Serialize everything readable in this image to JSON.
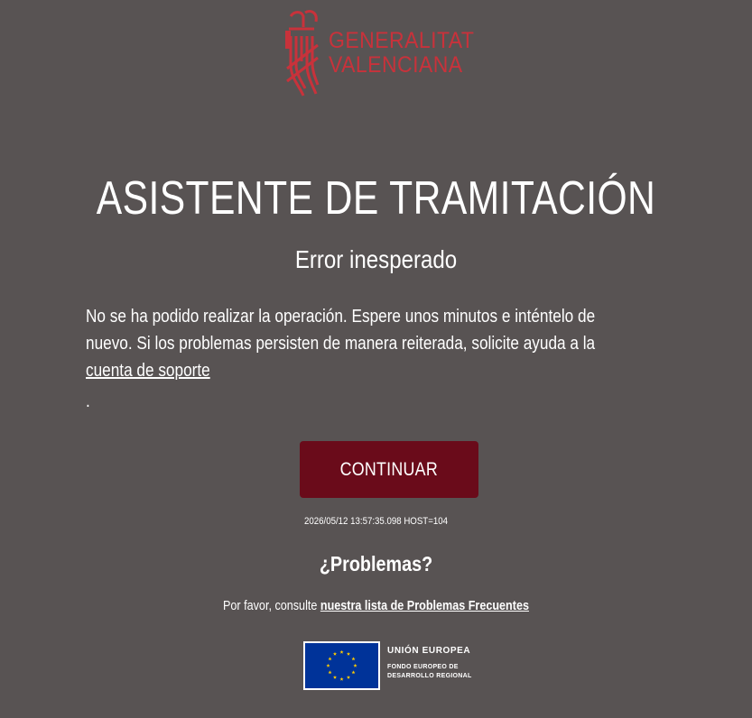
{
  "header": {
    "logo_line1": "GENERALITAT",
    "logo_line2": "VALENCIANA",
    "logo_icon": "generalitat-emblem-icon",
    "brand_color": "#c8323b"
  },
  "main": {
    "title": "ASISTENTE DE TRAMITACIÓN",
    "subtitle": "Error inesperado",
    "message": "No se ha podido realizar la operación. Espere unos minutos e inténtelo de nuevo. Si los problemas persisten de manera reiterada, solicite ayuda a la",
    "support_link": "cuenta de soporte",
    "message_end": ".",
    "continue_label": "CONTINUAR",
    "button_color": "#6a0b1a",
    "timestamp": "2026/05/12 13:57:35.098 HOST=104"
  },
  "problems": {
    "title": "¿Problemas?",
    "text": "Por favor, consulte",
    "link": "nuestra lista de Problemas Frecuentes"
  },
  "footer": {
    "eu_flag_icon": "eu-flag-icon",
    "eu_name": "UNIÓN EUROPEA",
    "eu_fund_line1": "FONDO EUROPEO DE",
    "eu_fund_line2": "DESARROLLO REGIONAL",
    "eu_blue": "#003399",
    "eu_gold": "#ffcc00"
  },
  "background_color": "#585353"
}
